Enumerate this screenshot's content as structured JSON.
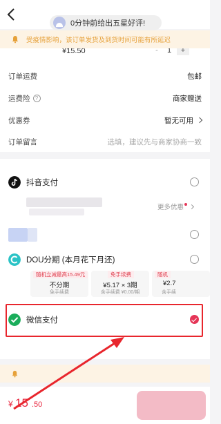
{
  "header": {
    "back_icon": "chevron-left-icon",
    "notice_pill": "0分钟前给出五星好评!"
  },
  "notice": {
    "text": "受疫情影响，该订单发货及到货时间可能有所延迟",
    "color": "#e6a13a"
  },
  "product": {
    "price": "¥15.50",
    "quantity": "1",
    "minus": "-",
    "plus": "+"
  },
  "order_rows": [
    {
      "label": "订单运费",
      "value": "包邮"
    },
    {
      "label": "运费险",
      "help": "?",
      "value": "商家赠送"
    },
    {
      "label": "优惠券",
      "value": "暂无可用"
    },
    {
      "label": "订单留言",
      "value": "选填，建议先与商家协商一致"
    }
  ],
  "payment": {
    "douyin": "抖音支付",
    "more_offers": "更多优惠",
    "dou_installment": "DOU分期 (本月花下月还)",
    "wechat": "微信支付",
    "selected": "wechat",
    "accent": "#e53557"
  },
  "plans": [
    {
      "tag": "随机立减最高15.49元",
      "main": "不分期",
      "sub": "免手续费"
    },
    {
      "tag": "免手续费",
      "main": "¥5.17 × 3期",
      "sub": "含手续费 ¥0.00/期"
    },
    {
      "tag": "随机",
      "main": "¥2.7",
      "sub": "含手续"
    }
  ],
  "footer": {
    "currency": "¥",
    "price_int": "15",
    "price_dec": ".50",
    "price_color": "#e8263e"
  }
}
